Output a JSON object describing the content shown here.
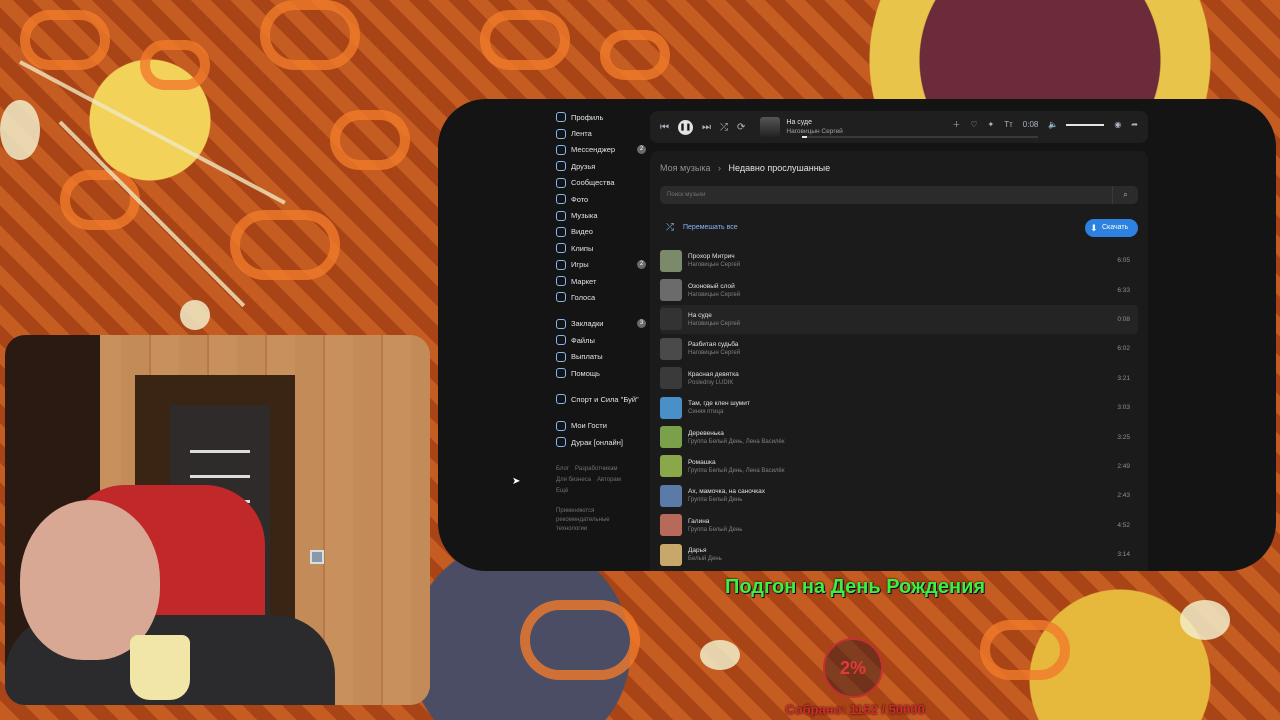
{
  "nav": {
    "items": [
      {
        "label": "Профиль",
        "badge": ""
      },
      {
        "label": "Лента",
        "badge": ""
      },
      {
        "label": "Мессенджер",
        "badge": "2"
      },
      {
        "label": "Друзья",
        "badge": ""
      },
      {
        "label": "Сообщества",
        "badge": ""
      },
      {
        "label": "Фото",
        "badge": ""
      },
      {
        "label": "Музыка",
        "badge": ""
      },
      {
        "label": "Видео",
        "badge": ""
      },
      {
        "label": "Клипы",
        "badge": ""
      },
      {
        "label": "Игры",
        "badge": "2"
      },
      {
        "label": "Маркет",
        "badge": ""
      },
      {
        "label": "Голоса",
        "badge": ""
      }
    ],
    "items2": [
      {
        "label": "Закладки",
        "badge": "3"
      },
      {
        "label": "Файлы",
        "badge": ""
      },
      {
        "label": "Выплаты",
        "badge": ""
      },
      {
        "label": "Помощь",
        "badge": ""
      }
    ],
    "items3": [
      {
        "label": "Спорт и Сила \"Буй\""
      }
    ],
    "items4": [
      {
        "label": "Мои Гости"
      },
      {
        "label": "Дурак [онлайн]"
      }
    ],
    "footer": {
      "blog": "Блог",
      "devs": "Разработчикам",
      "business": "Для бизнеса",
      "authors": "Авторам",
      "more": "Ещё",
      "tech": "Применяются рекомендательные технологии"
    }
  },
  "player": {
    "title": "На суде",
    "artist": "Наговицын Сергей",
    "time": "0:08",
    "progress": 0.02
  },
  "content": {
    "crumb_root": "Моя музыка",
    "crumb_current": "Недавно прослушанные",
    "search_placeholder": "Поиск музыки",
    "shuffle_label": "Перемешать все",
    "download_label": "Скачать",
    "tracks": [
      {
        "title": "Прохор Митрич",
        "artist": "Наговицын Сергей",
        "duration": "6:05",
        "color": "#7a8a6a"
      },
      {
        "title": "Озоновый слой",
        "artist": "Наговицын Сергей",
        "duration": "6:33",
        "color": "#6b6b6b"
      },
      {
        "title": "На суде",
        "artist": "Наговицын Сергей",
        "duration": "0:08",
        "color": "#333333"
      },
      {
        "title": "Разбитая судьба",
        "artist": "Наговицын Сергей",
        "duration": "6:02",
        "color": "#4a4a4a"
      },
      {
        "title": "Красная девятка",
        "artist": "Posledniy LUDIK",
        "duration": "3:21",
        "color": "#3a3a3a"
      },
      {
        "title": "Там, где клен шумит",
        "artist": "Синяя птица",
        "duration": "3:03",
        "color": "#4a90c8"
      },
      {
        "title": "Деревенька",
        "artist": "Группа Белый День, Лена Василёк",
        "duration": "3:25",
        "color": "#7aa04a"
      },
      {
        "title": "Ромашка",
        "artist": "Группа Белый День, Лена Василёк",
        "duration": "2:49",
        "color": "#8aa84a"
      },
      {
        "title": "Ах, мамочка, на саночках",
        "artist": "Группа Белый День",
        "duration": "2:43",
        "color": "#5a7aa8"
      },
      {
        "title": "Галина",
        "artist": "Группа Белый День",
        "duration": "4:52",
        "color": "#b86a5a"
      },
      {
        "title": "Дарья",
        "artist": "Белый День",
        "duration": "3:14",
        "color": "#c8a86a"
      }
    ]
  },
  "overlay": {
    "goal_title": "Подгон на День Рождения",
    "percent": "2%",
    "collected": "Собрано: 1152 / 50000"
  }
}
